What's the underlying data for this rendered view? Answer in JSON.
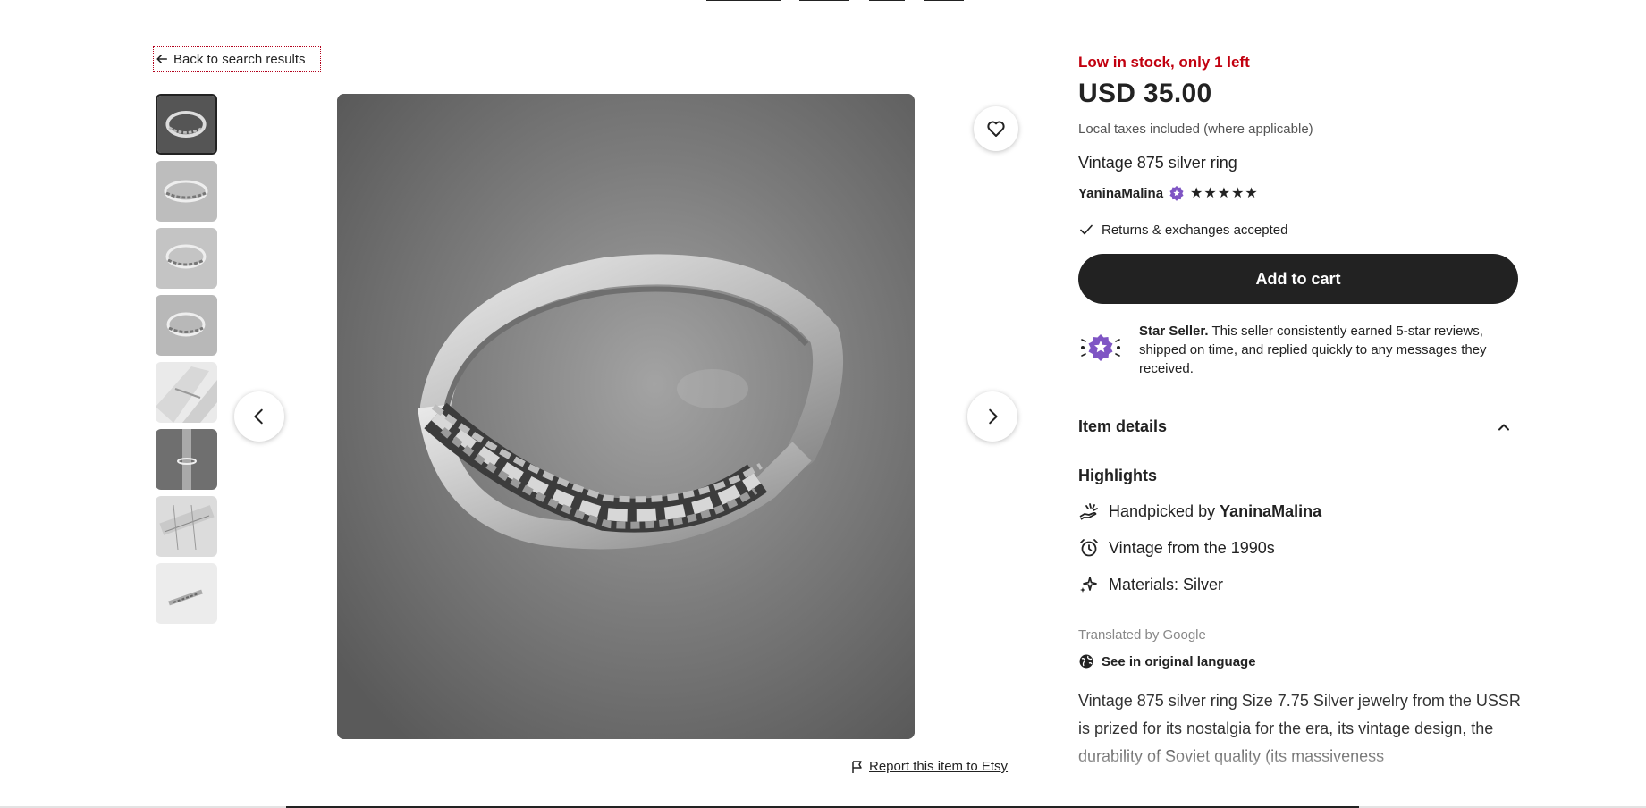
{
  "back_link": {
    "label": "Back to search results",
    "icon": "arrow-left-icon"
  },
  "listing": {
    "stock_status": "Low in stock, only 1 left",
    "price": "USD 35.00",
    "taxes_note": "Local taxes included (where applicable)",
    "title": "Vintage 875 silver ring",
    "seller": {
      "name": "YaninaMalina",
      "badge_icon": "star-seller-badge-icon",
      "stars": "★★★★★",
      "rating": 5
    },
    "returns": "Returns & exchanges accepted",
    "add_to_cart": "Add to cart",
    "star_seller": {
      "title": "Star Seller.",
      "text": " This seller consistently earned 5-star reviews, shipped on time, and replied quickly to any messages they received."
    },
    "item_details": {
      "label": "Item details",
      "expanded": true
    },
    "highlights": {
      "heading": "Highlights",
      "handpicked_prefix": "Handpicked by",
      "handpicked_name": "YaninaMalina",
      "vintage": "Vintage from the 1990s",
      "materials": "Materials: Silver"
    },
    "translated_by": "Translated by Google",
    "see_original": "See in original language",
    "description": "Vintage 875 silver ring Size 7.75 Silver jewelry from the USSR is prized for its nostalgia for the era, its vintage design, the durability of Soviet quality (its massiveness"
  },
  "gallery": {
    "thumbnail_count": 8,
    "active_index": 0,
    "prev_icon": "chevron-left-icon",
    "next_icon": "chevron-right-icon",
    "favorite_icon": "heart-icon"
  },
  "report_link": {
    "label": "Report this item to Etsy",
    "icon": "flag-icon"
  },
  "colors": {
    "stock_red": "#c2000f",
    "primary_dark": "#222222",
    "star_purple": "#7f55c4"
  }
}
